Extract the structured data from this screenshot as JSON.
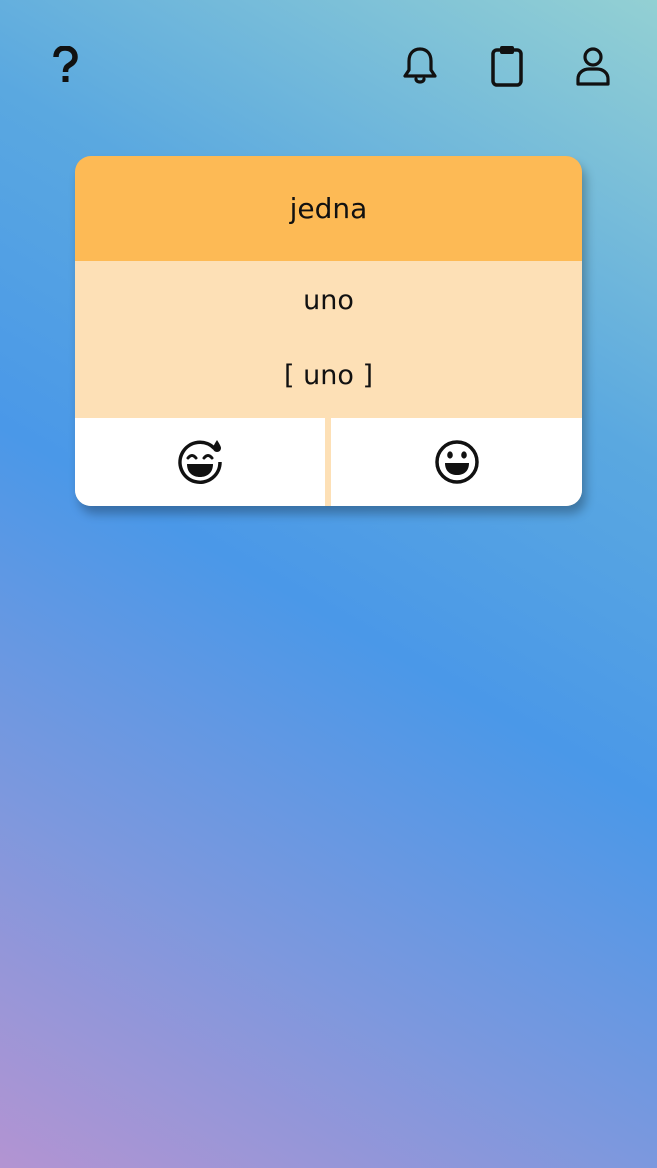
{
  "header": {
    "help_icon": "question-mark-icon",
    "notifications_icon": "bell-icon",
    "tasks_icon": "clipboard-icon",
    "profile_icon": "user-icon"
  },
  "flashcard": {
    "front_text": "jedna",
    "back_text": "uno",
    "pronunciation": "[ uno ]",
    "colors": {
      "front": "#fdba55",
      "back": "#fde0b6"
    }
  },
  "answers": {
    "hard_icon": "grinning-face-with-sweat-icon",
    "easy_icon": "grinning-face-icon"
  }
}
